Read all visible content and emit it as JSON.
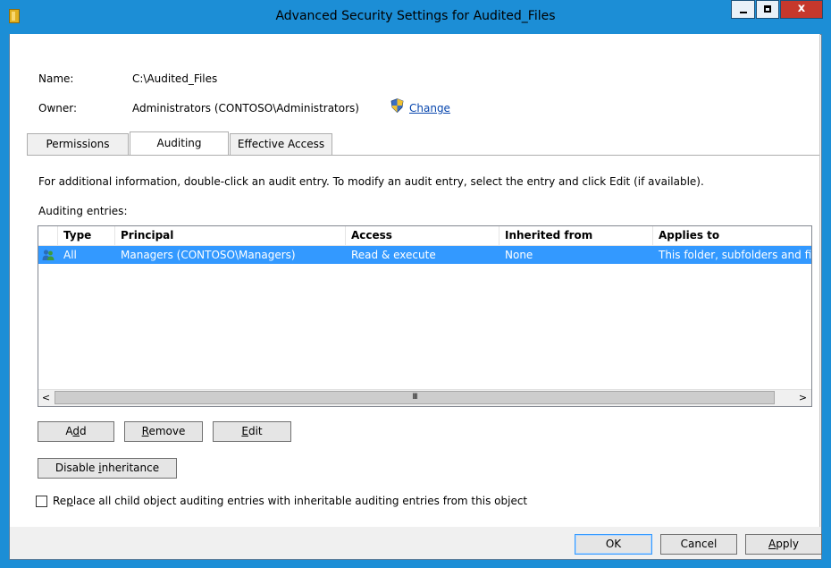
{
  "window": {
    "title": "Advanced Security Settings for Audited_Files",
    "close_glyph": "x"
  },
  "object": {
    "name_label": "Name:",
    "name_value": "C:\\Audited_Files",
    "owner_label": "Owner:",
    "owner_value": "Administrators (CONTOSO\\Administrators)",
    "change_link": "Change"
  },
  "tabs": [
    {
      "label": "Permissions",
      "active": false
    },
    {
      "label": "Auditing",
      "active": true
    },
    {
      "label": "Effective Access",
      "active": false
    }
  ],
  "auditing": {
    "info_text": "For additional information, double-click an audit entry. To modify an audit entry, select the entry and click Edit (if available).",
    "entries_label": "Auditing entries:",
    "columns": [
      "Type",
      "Principal",
      "Access",
      "Inherited from",
      "Applies to"
    ],
    "rows": [
      {
        "icon": "users-icon",
        "type": "All",
        "principal": "Managers (CONTOSO\\Managers)",
        "access": "Read & execute",
        "inherited_from": "None",
        "applies_to": "This folder, subfolders and files",
        "selected": true
      }
    ],
    "scroll_left": "<",
    "scroll_right": ">",
    "scroll_thumb_grip": "III"
  },
  "buttons": {
    "add_pre": "A",
    "add_u": "d",
    "add_post": "d",
    "remove_pre": "",
    "remove_u": "R",
    "remove_post": "emove",
    "edit_pre": "",
    "edit_u": "E",
    "edit_post": "dit",
    "disable_pre": "Disable ",
    "disable_u": "i",
    "disable_post": "nheritance",
    "ok": "OK",
    "cancel": "Cancel",
    "apply_pre": "",
    "apply_u": "A",
    "apply_post": "pply"
  },
  "replace_checkbox": {
    "checked": false,
    "label_pre": "Re",
    "label_u": "p",
    "label_post": "lace all child object auditing entries with inheritable auditing entries from this object"
  },
  "colors": {
    "window_frame": "#1c8ed6",
    "selection": "#3399ff",
    "close_button": "#c6382c"
  }
}
